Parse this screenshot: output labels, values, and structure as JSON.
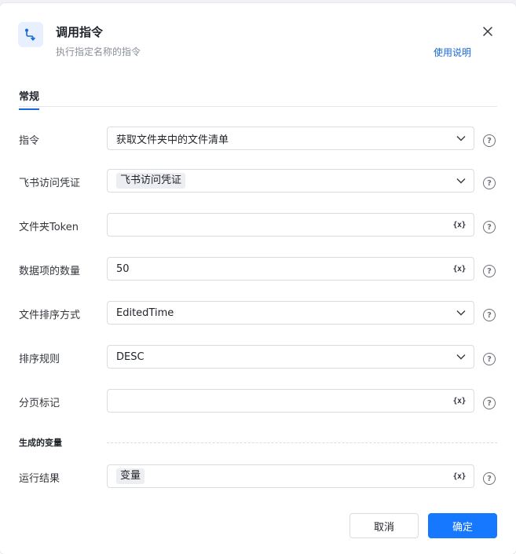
{
  "header": {
    "icon": "flow-branch-icon",
    "title": "调用指令",
    "subtitle": "执行指定名称的指令",
    "help_link": "使用说明",
    "accent_color": "#1668dc"
  },
  "tabs": [
    {
      "label": "常规",
      "active": true
    }
  ],
  "fields": [
    {
      "label": "指令",
      "value": "获取文件夹中的文件清单",
      "kind": "select"
    },
    {
      "label": "飞书访问凭证",
      "value": "飞书访问凭证",
      "kind": "select-tag"
    },
    {
      "label": "文件夹Token",
      "value": "",
      "kind": "variable-input"
    },
    {
      "label": "数据项的数量",
      "value": "50",
      "kind": "variable-input"
    },
    {
      "label": "文件排序方式",
      "value": "EditedTime",
      "kind": "select"
    },
    {
      "label": "排序规则",
      "value": "DESC",
      "kind": "select"
    },
    {
      "label": "分页标记",
      "value": "",
      "kind": "variable-input"
    }
  ],
  "output_section": {
    "title": "生成的变量",
    "fields": [
      {
        "label": "运行结果",
        "value": "变量",
        "kind": "variable-tag"
      }
    ]
  },
  "variable_icon_text": "{x}",
  "help_icon_text": "?",
  "footer": {
    "cancel_label": "取消",
    "ok_label": "确定",
    "ok_color": "#1677ff"
  }
}
